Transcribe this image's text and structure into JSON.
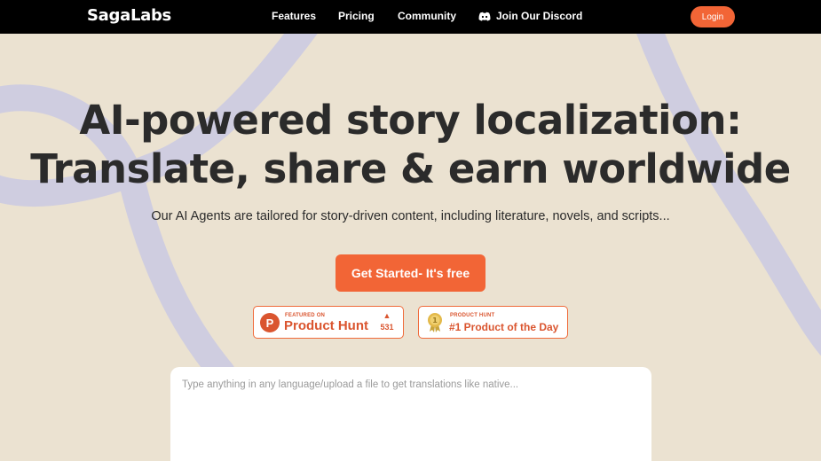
{
  "nav": {
    "logo": "SagaLabs",
    "links": [
      "Features",
      "Pricing",
      "Community"
    ],
    "discord_label": "Join Our Discord",
    "discord_icon": "discord-icon",
    "login_label": "Login"
  },
  "hero": {
    "title_line1": "AI-powered story localization:",
    "title_line2": "Translate, share & earn worldwide",
    "subtitle": "Our AI Agents are tailored for story-driven content, including literature, novels, and scripts...",
    "cta_label": "Get Started- It's free"
  },
  "badges": {
    "product_hunt": {
      "letter": "P",
      "small": "FEATURED ON",
      "big": "Product Hunt",
      "votes": "531",
      "icon": "upvote-triangle-icon"
    },
    "product_of_day": {
      "small": "PRODUCT HUNT",
      "big": "#1 Product of the Day",
      "icon": "medal-icon"
    }
  },
  "translator": {
    "placeholder": "Type anything in any language/upload a file to get translations like native..."
  },
  "colors": {
    "accent": "#f26536",
    "nav_bg": "#000000",
    "page_bg": "#ebe2d1",
    "swirl": "#cfcde0"
  }
}
